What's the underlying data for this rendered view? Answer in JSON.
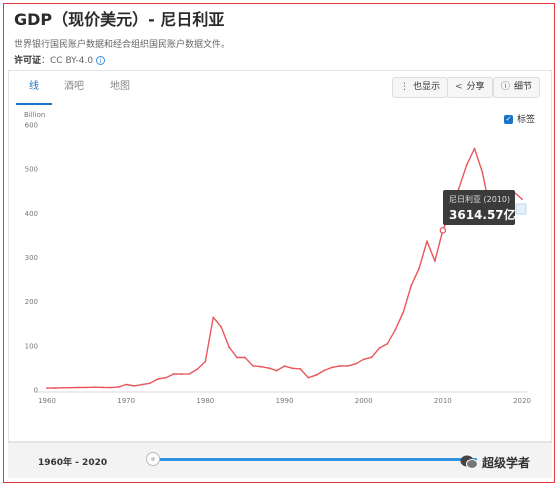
{
  "header": {
    "title": "GDP（现价美元）- 尼日利亚",
    "subtitle": "世界银行国民账户数据和经合组织国民账户数据文件。",
    "license_label": "许可证",
    "license_value": "：CC BY-4.0"
  },
  "tabs": [
    {
      "label": "线",
      "active": true
    },
    {
      "label": "酒吧",
      "active": false
    },
    {
      "label": "地图",
      "active": false
    }
  ],
  "toolbar": {
    "also_show": "也显示",
    "share": "分享",
    "details": "细节"
  },
  "labels_checkbox": {
    "label": "标签",
    "checked": true
  },
  "chart_data": {
    "type": "line",
    "unit_label": "Billion",
    "ylim": [
      0,
      600
    ],
    "yticks": [
      0,
      100,
      200,
      300,
      400,
      500,
      600
    ],
    "xticks": [
      1960,
      1970,
      1980,
      1990,
      2000,
      2010,
      2020
    ],
    "grid": false,
    "color": "#e8575b",
    "x": [
      1960,
      1961,
      1962,
      1963,
      1964,
      1965,
      1966,
      1967,
      1968,
      1969,
      1970,
      1971,
      1972,
      1973,
      1974,
      1975,
      1976,
      1977,
      1978,
      1979,
      1980,
      1981,
      1982,
      1983,
      1984,
      1985,
      1986,
      1987,
      1988,
      1989,
      1990,
      1991,
      1992,
      1993,
      1994,
      1995,
      1996,
      1997,
      1998,
      1999,
      2000,
      2001,
      2002,
      2003,
      2004,
      2005,
      2006,
      2007,
      2008,
      2009,
      2010,
      2011,
      2012,
      2013,
      2014,
      2015,
      2016,
      2017,
      2018,
      2019,
      2020
    ],
    "values": [
      4.2,
      4.5,
      5.0,
      5.3,
      5.6,
      6.0,
      6.4,
      5.9,
      5.4,
      6.6,
      12.5,
      9.2,
      12.3,
      15.2,
      24.8,
      27.8,
      36.3,
      36.0,
      36.5,
      47.3,
      64.2,
      164.5,
      142.8,
      97.1,
      73.5,
      73.7,
      54.8,
      52.7,
      49.6,
      44.0,
      54.0,
      49.1,
      47.8,
      27.8,
      33.8,
      44.1,
      51.1,
      54.5,
      54.6,
      59.4,
      69.4,
      74.0,
      95.1,
      104.9,
      136.4,
      176.1,
      236.1,
      275.6,
      337.0,
      291.9,
      361.5,
      404.9,
      455.5,
      508.7,
      546.7,
      493.0,
      404.6,
      375.7,
      421.7,
      448.1,
      432.3
    ]
  },
  "tooltip": {
    "name": "尼日利亚 (2010)",
    "value": "3614.57亿",
    "point_year": 2010,
    "point_value": 361.457
  },
  "range": {
    "label": "1960年 - 2020"
  },
  "watermark": {
    "text": "超级学者"
  }
}
